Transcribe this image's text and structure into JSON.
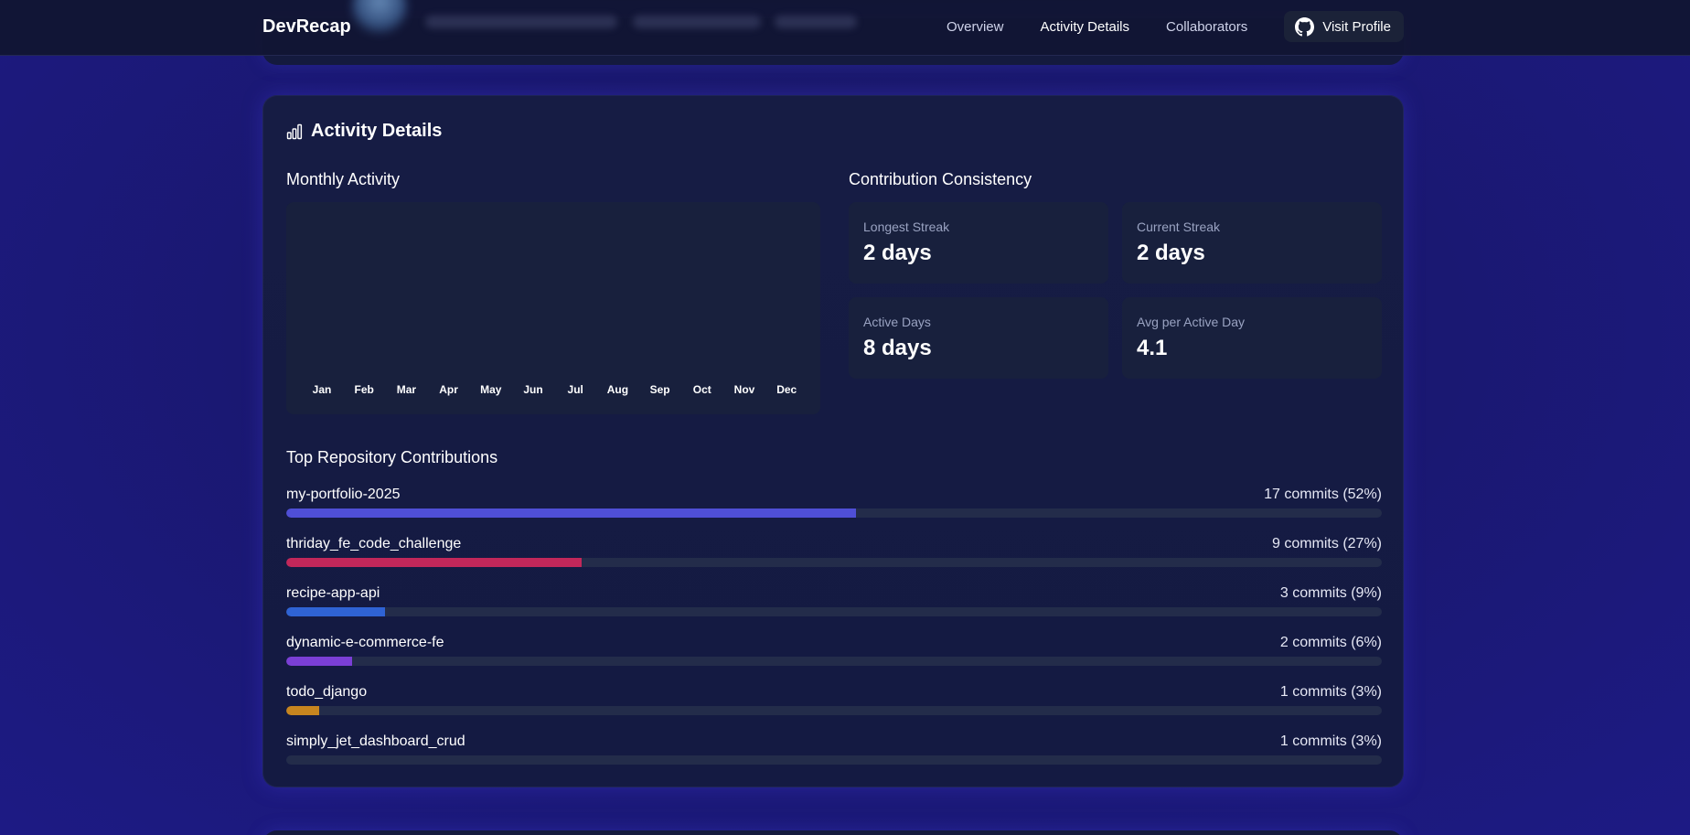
{
  "nav": {
    "brand": "DevRecap",
    "links": [
      {
        "label": "Overview",
        "active": false
      },
      {
        "label": "Activity Details",
        "active": true
      },
      {
        "label": "Collaborators",
        "active": false
      }
    ],
    "visit_button": {
      "label": "Visit Profile",
      "icon": "github-icon"
    }
  },
  "activity": {
    "title": "Activity Details",
    "title_icon": "bar-chart-icon",
    "monthly": {
      "title": "Monthly Activity",
      "months": [
        "Jan",
        "Feb",
        "Mar",
        "Apr",
        "May",
        "Jun",
        "Jul",
        "Aug",
        "Sep",
        "Oct",
        "Nov",
        "Dec"
      ]
    },
    "consistency": {
      "title": "Contribution Consistency",
      "stats": [
        {
          "label": "Longest Streak",
          "value": "2 days"
        },
        {
          "label": "Current Streak",
          "value": "2 days"
        },
        {
          "label": "Active Days",
          "value": "8 days"
        },
        {
          "label": "Avg per Active Day",
          "value": "4.1"
        }
      ]
    },
    "repos": {
      "title": "Top Repository Contributions",
      "items": [
        {
          "name": "my-portfolio-2025",
          "count": "17 commits (52%)",
          "percent": 52,
          "color": "#4f4fd6"
        },
        {
          "name": "thriday_fe_code_challenge",
          "count": "9 commits (27%)",
          "percent": 27,
          "color": "#c2275a"
        },
        {
          "name": "recipe-app-api",
          "count": "3 commits (9%)",
          "percent": 9,
          "color": "#2f63d4"
        },
        {
          "name": "dynamic-e-commerce-fe",
          "count": "2 commits (6%)",
          "percent": 6,
          "color": "#7b3fd6"
        },
        {
          "name": "todo_django",
          "count": "1 commits (3%)",
          "percent": 3,
          "color": "#c7851f"
        },
        {
          "name": "simply_jet_dashboard_crud",
          "count": "1 commits (3%)",
          "percent": 0,
          "color": "#232c4a"
        }
      ]
    }
  }
}
